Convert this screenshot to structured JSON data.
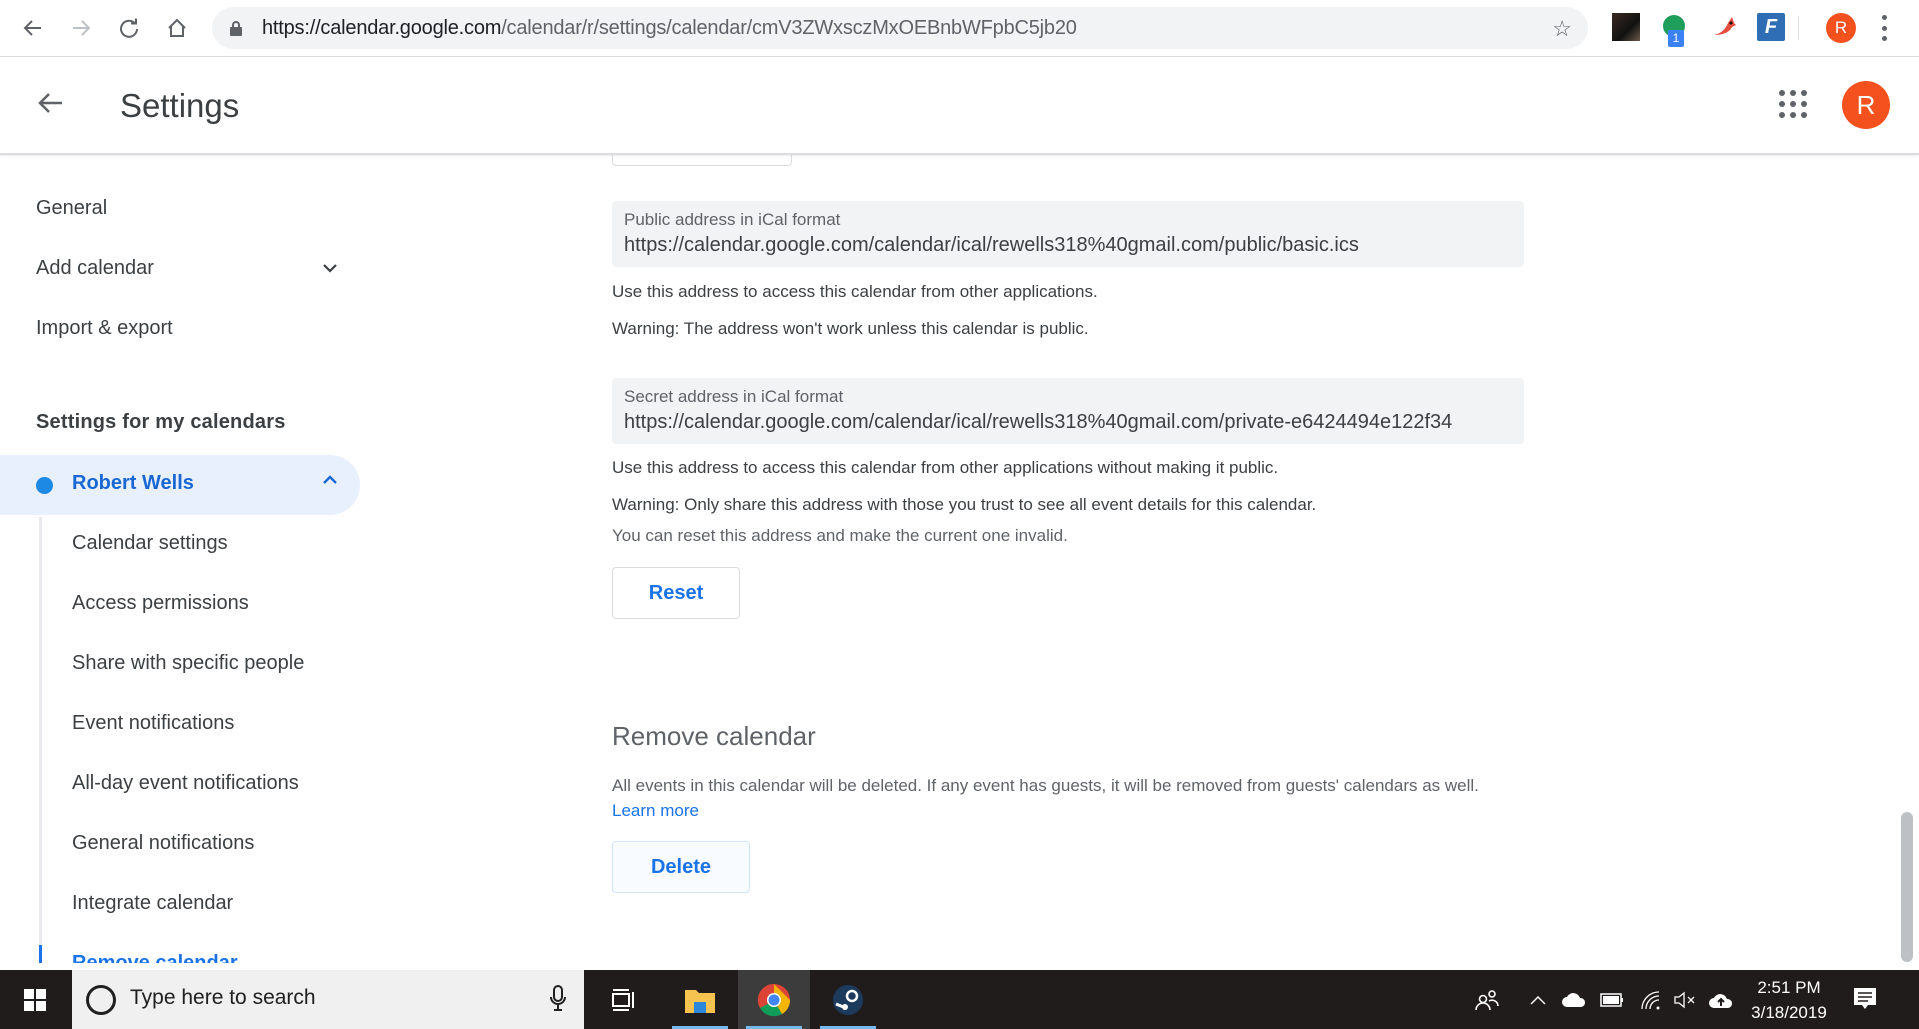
{
  "browser": {
    "url_host": "https://calendar.google.com",
    "url_path": "/calendar/r/settings/calendar/cmV3ZWxsczMxOEBnbWFpbC5jb20",
    "extension_badge": "1",
    "profile_initial": "R"
  },
  "header": {
    "title": "Settings",
    "avatar_initial": "R"
  },
  "sidebar": {
    "items": [
      {
        "label": "General"
      },
      {
        "label": "Add calendar"
      },
      {
        "label": "Import & export"
      }
    ],
    "section_heading": "Settings for my calendars",
    "calendar": {
      "name": "Robert Wells",
      "color": "#1e88e5"
    },
    "sub_items": [
      {
        "label": "Calendar settings"
      },
      {
        "label": "Access permissions"
      },
      {
        "label": "Share with specific people"
      },
      {
        "label": "Event notifications"
      },
      {
        "label": "All-day event notifications"
      },
      {
        "label": "General notifications"
      },
      {
        "label": "Integrate calendar"
      },
      {
        "label": "Remove calendar",
        "active": true
      }
    ]
  },
  "main": {
    "public_ical": {
      "label": "Public address in iCal format",
      "value": "https://calendar.google.com/calendar/ical/rewells318%40gmail.com/public/basic.ics",
      "help": "Use this address to access this calendar from other applications.",
      "warning": "Warning: The address won't work unless this calendar is public."
    },
    "secret_ical": {
      "label": "Secret address in iCal format",
      "value": "https://calendar.google.com/calendar/ical/rewells318%40gmail.com/private-e6424494e122f34",
      "help": "Use this address to access this calendar from other applications without making it public.",
      "warning": "Warning: Only share this address with those you trust to see all event details for this calendar.",
      "reset_note": "You can reset this address and make the current one invalid.",
      "reset_label": "Reset"
    },
    "remove": {
      "title": "Remove calendar",
      "description": "All events in this calendar will be deleted. If any event has guests, it will be removed from guests' calendars as well.",
      "learn_more": "Learn more",
      "delete_label": "Delete"
    }
  },
  "taskbar": {
    "search_placeholder": "Type here to search",
    "time": "2:51 PM",
    "date": "3/18/2019"
  }
}
